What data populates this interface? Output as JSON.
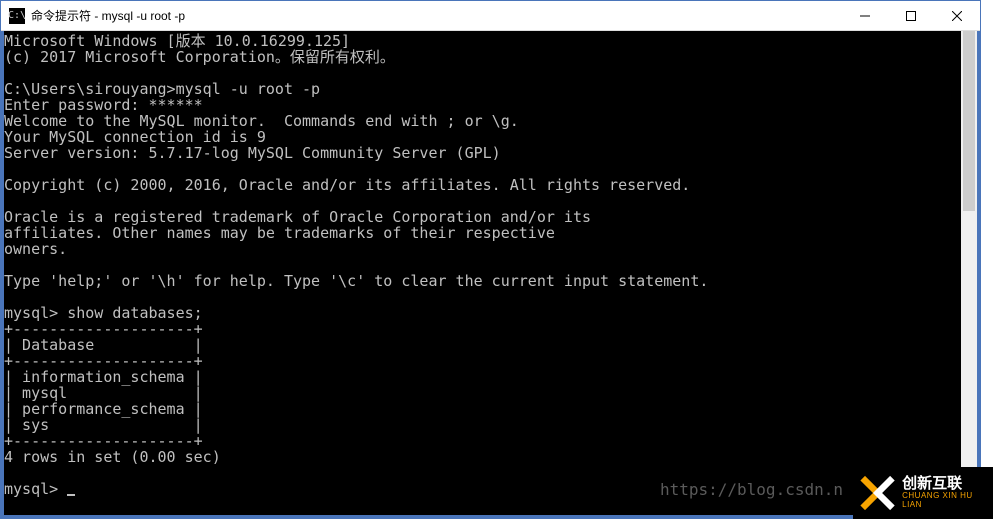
{
  "window": {
    "title": "命令提示符 - mysql  -u root -p"
  },
  "terminal": {
    "lines": [
      "Microsoft Windows [版本 10.0.16299.125]",
      "(c) 2017 Microsoft Corporation。保留所有权利。",
      "",
      "C:\\Users\\sirouyang>mysql -u root -p",
      "Enter password: ******",
      "Welcome to the MySQL monitor.  Commands end with ; or \\g.",
      "Your MySQL connection id is 9",
      "Server version: 5.7.17-log MySQL Community Server (GPL)",
      "",
      "Copyright (c) 2000, 2016, Oracle and/or its affiliates. All rights reserved.",
      "",
      "Oracle is a registered trademark of Oracle Corporation and/or its",
      "affiliates. Other names may be trademarks of their respective",
      "owners.",
      "",
      "Type 'help;' or '\\h' for help. Type '\\c' to clear the current input statement.",
      "",
      "mysql> show databases;",
      "+--------------------+",
      "| Database           |",
      "+--------------------+",
      "| information_schema |",
      "| mysql              |",
      "| performance_schema |",
      "| sys                |",
      "+--------------------+",
      "4 rows in set (0.00 sec)",
      "",
      "mysql> "
    ]
  },
  "watermark": "https://blog.csdn.n",
  "logo": {
    "cn": "创新互联",
    "en": "CHUANG XIN HU LIAN"
  }
}
